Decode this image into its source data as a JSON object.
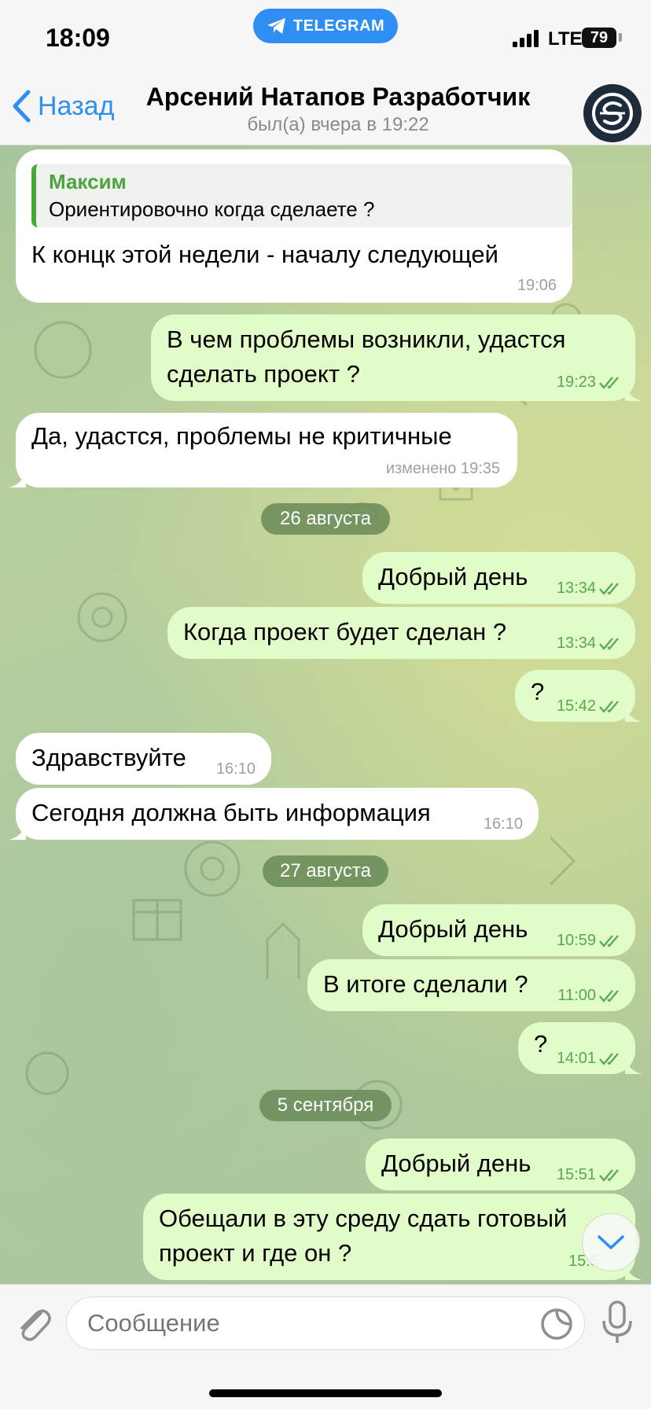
{
  "status_bar": {
    "time": "18:09",
    "app_pill": "TELEGRAM",
    "network": "LTE",
    "battery": "79"
  },
  "header": {
    "back_label": "Назад",
    "title": "Арсений Натапов Разработчик",
    "status": "был(а) вчера в 19:22"
  },
  "messages": [
    {
      "direction": "in",
      "reply_author": "Максим",
      "reply_text": "Ориентировочно когда сделаете ?",
      "text": "К концк этой недели - началу следующей",
      "time": "19:06"
    },
    {
      "direction": "out",
      "text_lines": [
        "В чем проблемы возникли, удастся",
        "сделать проект ?"
      ],
      "time": "19:23"
    },
    {
      "direction": "in",
      "text": "Да, удастся, проблемы не критичные",
      "time": "изменено 19:35"
    },
    {
      "direction": "out",
      "text": "Добрый день",
      "time": "13:34"
    },
    {
      "direction": "out",
      "text": "Когда проект будет сделан ?",
      "time": "13:34"
    },
    {
      "direction": "out",
      "text": "?",
      "time": "15:42"
    },
    {
      "direction": "in",
      "text": "Здравствуйте",
      "time": "16:10"
    },
    {
      "direction": "in",
      "text": "Сегодня должна быть информация",
      "time": "16:10"
    },
    {
      "direction": "out",
      "text": "Добрый день",
      "time": "10:59"
    },
    {
      "direction": "out",
      "text": "В итоге сделали ?",
      "time": "11:00"
    },
    {
      "direction": "out",
      "text": "?",
      "time": "14:01"
    },
    {
      "direction": "out",
      "text": "Добрый день",
      "time": "15:51"
    },
    {
      "direction": "out",
      "text_lines": [
        "Обещали в эту среду сдать готовый",
        "проект и где он ?"
      ],
      "time": "15:5"
    }
  ],
  "date_separators": [
    "26 августа",
    "27 августа",
    "5 сентября"
  ],
  "composer": {
    "placeholder": "Сообщение"
  },
  "colors": {
    "accent": "#2f8ef3",
    "outgoing_bubble": "#e2fcc9",
    "incoming_bubble": "#ffffff",
    "read_checks": "#55a94c",
    "reply_author": "#4aa53f"
  },
  "icons": [
    "telegram-plane-icon",
    "signal-icon",
    "back-chevron-icon",
    "avatar-logo-icon",
    "double-check-icon",
    "paperclip-icon",
    "sticker-icon",
    "microphone-icon",
    "chevron-down-icon"
  ]
}
